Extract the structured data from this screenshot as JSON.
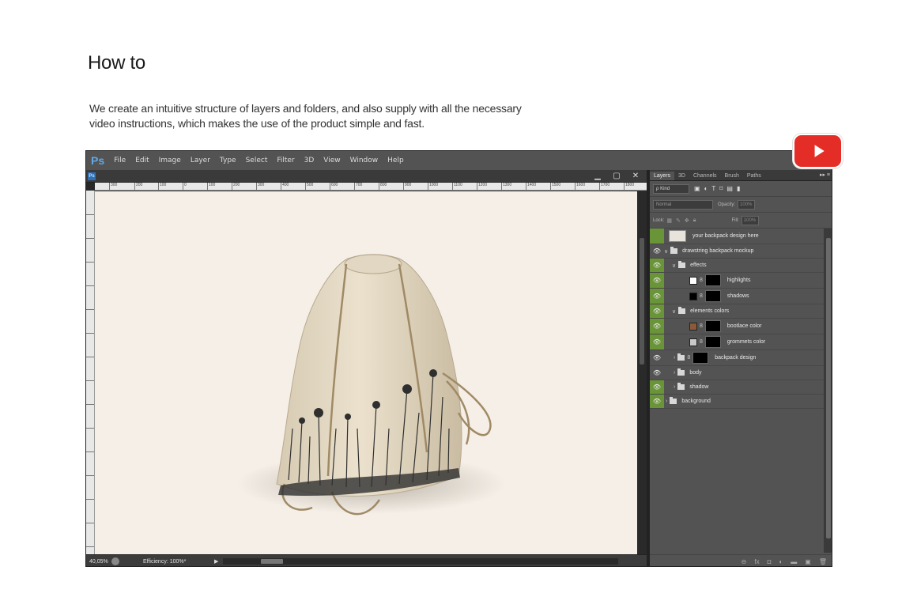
{
  "page": {
    "title": "How to",
    "description_line1": "We create an intuitive structure of layers and folders, and also supply with all the necessary",
    "description_line2": "video instructions, which makes the use of the product simple and fast."
  },
  "colors": {
    "youtube_red": "#e52d27",
    "layer_visible_green": "#6a9438",
    "ps_blue": "#5fa9e6",
    "canvas_bg": "#f5efe7"
  },
  "photoshop": {
    "logo": "Ps",
    "menu": [
      "File",
      "Edit",
      "Image",
      "Layer",
      "Type",
      "Select",
      "Filter",
      "3D",
      "View",
      "Window",
      "Help"
    ],
    "doc_icon": "Ps",
    "window_controls": [
      "▁",
      "▢",
      "✕"
    ],
    "ruler_labels": [
      "300",
      "200",
      "100",
      "0",
      "100",
      "200",
      "300",
      "400",
      "500",
      "600",
      "700",
      "800",
      "900",
      "1000",
      "1100",
      "1200",
      "1300",
      "1400",
      "1500",
      "1600",
      "1700",
      "1800"
    ],
    "status": {
      "zoom": "40,05%",
      "efficiency": "Efficiency: 100%*"
    },
    "panel_tabs": [
      "Layers",
      "3D",
      "Channels",
      "Brush",
      "Paths"
    ],
    "panel_menu": "▸▸ ≡",
    "filter_kind": "ρ Kind",
    "blend_mode": "Normal",
    "opacity_label": "Opacity:",
    "opacity_value": "100%",
    "lock_label": "Lock:",
    "fill_label": "Fill:",
    "fill_value": "100%",
    "layers": [
      {
        "name": "your backpack design here"
      },
      {
        "name": "drawstring backpack mockup"
      },
      {
        "name": "effects"
      },
      {
        "name": "highlights"
      },
      {
        "name": "shadows"
      },
      {
        "name": "elements colors"
      },
      {
        "name": "bootlace color"
      },
      {
        "name": "grommets color"
      },
      {
        "name": "backpack design"
      },
      {
        "name": "body"
      },
      {
        "name": "shadow"
      },
      {
        "name": "background"
      }
    ]
  },
  "icons": {
    "youtube": "youtube-play-icon",
    "eye": "eye-icon",
    "folder": "folder-icon",
    "chain": "chain-link-icon"
  }
}
